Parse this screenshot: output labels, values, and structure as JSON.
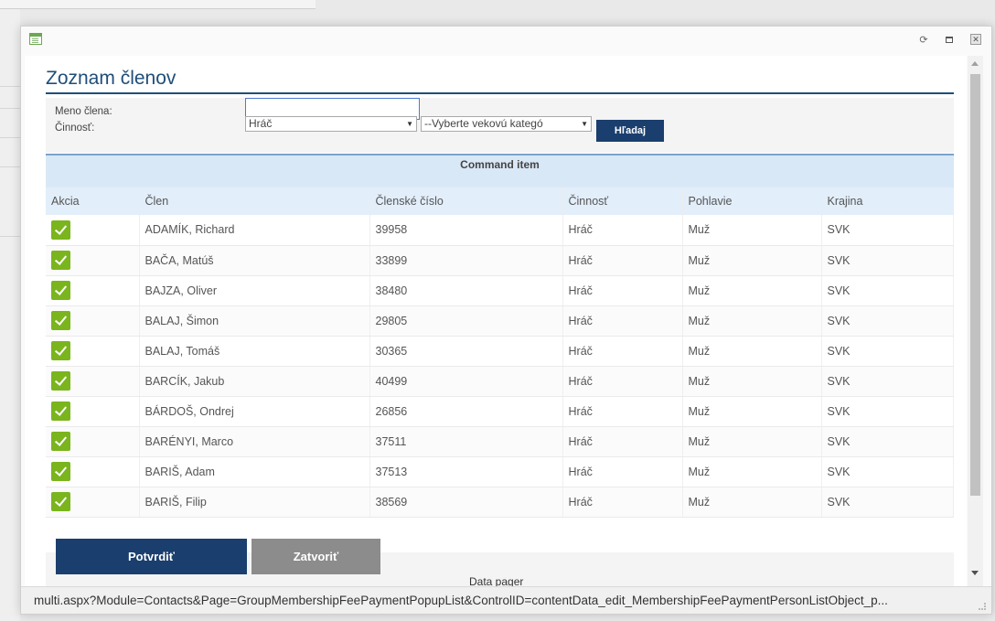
{
  "popup": {
    "status_url": "multi.aspx?Module=Contacts&Page=GroupMembershipFeePaymentPopupList&ControlID=contentData_edit_MembershipFeePaymentPersonListObject_p..."
  },
  "page_title": "Zoznam členov",
  "filter": {
    "name_label": "Meno člena:",
    "activity_label": "Činnosť:",
    "name_value": "",
    "activity_selected": "Hráč",
    "age_category_selected": "--Vyberte vekovú kategó",
    "search_button": "Hľadaj"
  },
  "command_bar": "Command item",
  "table": {
    "headers": [
      "Akcia",
      "Člen",
      "Členské číslo",
      "Činnosť",
      "Pohlavie",
      "Krajina"
    ],
    "rows": [
      {
        "member": "ADAMÍK, Richard",
        "number": "39958",
        "activity": "Hráč",
        "gender": "Muž",
        "country": "SVK",
        "checked": true
      },
      {
        "member": "BAČA, Matúš",
        "number": "33899",
        "activity": "Hráč",
        "gender": "Muž",
        "country": "SVK",
        "checked": true
      },
      {
        "member": "BAJZA, Oliver",
        "number": "38480",
        "activity": "Hráč",
        "gender": "Muž",
        "country": "SVK",
        "checked": true
      },
      {
        "member": "BALAJ, Šimon",
        "number": "29805",
        "activity": "Hráč",
        "gender": "Muž",
        "country": "SVK",
        "checked": true
      },
      {
        "member": "BALAJ, Tomáš",
        "number": "30365",
        "activity": "Hráč",
        "gender": "Muž",
        "country": "SVK",
        "checked": true
      },
      {
        "member": "BARCÍK, Jakub",
        "number": "40499",
        "activity": "Hráč",
        "gender": "Muž",
        "country": "SVK",
        "checked": true
      },
      {
        "member": "BÁRDOŠ, Ondrej",
        "number": "26856",
        "activity": "Hráč",
        "gender": "Muž",
        "country": "SVK",
        "checked": true
      },
      {
        "member": "BARÉNYI, Marco",
        "number": "37511",
        "activity": "Hráč",
        "gender": "Muž",
        "country": "SVK",
        "checked": true
      },
      {
        "member": "BARIŠ, Adam",
        "number": "37513",
        "activity": "Hráč",
        "gender": "Muž",
        "country": "SVK",
        "checked": true
      },
      {
        "member": "BARIŠ, Filip",
        "number": "38569",
        "activity": "Hráč",
        "gender": "Muž",
        "country": "SVK",
        "checked": true
      }
    ]
  },
  "footer": {
    "confirm_button": "Potvrdiť",
    "close_button": "Zatvoriť",
    "pager_label": "Data pager"
  },
  "colors": {
    "primary": "#1a3f6e",
    "title": "#1f4e79",
    "check": "#7ab51d",
    "header_bg": "#e2eefa",
    "command_bg": "#d9e8f6"
  }
}
